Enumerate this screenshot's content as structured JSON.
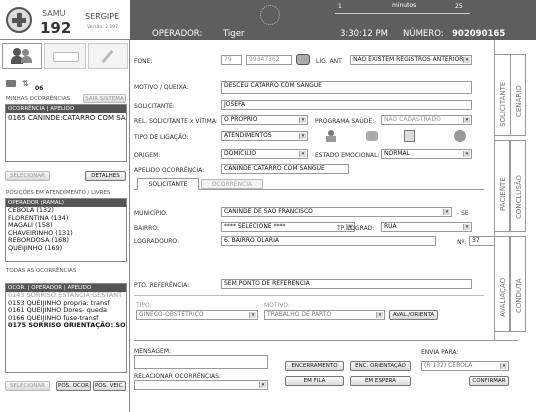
{
  "header": {
    "logo_brand": "SAMU",
    "logo_number": "192",
    "city": "SERGIPE",
    "version": "Versão: 2.197",
    "timer_minutes_left": "1",
    "timer_label": "minutos",
    "timer_minutes_right": "25",
    "operator_label": "OPERADOR:",
    "operator_name": "Tiger",
    "clock": "3:30:12 PM",
    "number_label": "NÚMERO:",
    "number_value": "902090165"
  },
  "sidebar": {
    "messages_count": "06",
    "my_occurrences_label": "MINHAS OCORRÊNCIAS",
    "exit_system_button": "SAIR SISTEMA",
    "my_list_header": "OCORRÊNCIA | APELIDO",
    "my_list_items": [
      "0165 CANINDE:CATARRO COM SAN"
    ],
    "select_button": "SELECIONAR",
    "details_button": "DETALHES",
    "positions_label": "POSIÇÕES EM ATENDIMENTO / LIVRES",
    "operators_header": "OPERADOR (RAMAL)",
    "operators": [
      "CEBOLA (132)",
      "FLORENTINA (134)",
      "MAGALI (158)",
      "CHAVEIRINHO (131)",
      "REBORDOSA (168)",
      "QUEIJINHO (169)"
    ],
    "all_occurrences_label": "TODAS AS OCORRÊNCIAS",
    "all_header": "OCOR. | OPERADOR | APELIDO",
    "all_items": [
      {
        "text": "0143 SORRISO ESTANCIA:GESTANT",
        "muted": true
      },
      {
        "text": "0153 QUEIJINHO propria: transf",
        "muted": false
      },
      {
        "text": "0161 QUEIJINHO Dores- queda",
        "muted": false
      },
      {
        "text": "0166 QUEIJINHO fuse-transf",
        "muted": false
      },
      {
        "text": "0175 SORRISO ORIENTAÇÃO: SOCC",
        "muted": false
      }
    ],
    "select_button_2": "SELECIONAR",
    "pos_ocor_button": "POS. OCOR",
    "pos_veic_button": "POS. VEIC."
  },
  "form": {
    "phone_label": "FONE:",
    "phone_ddd": "79",
    "phone_number": "99347362",
    "lig_ant_label": "LIG. ANT",
    "lig_ant_value": "NÃO EXISTEM REGISTROS ANTERIOR",
    "motivo_label": "MOTIVO / QUEIXA:",
    "motivo_value": "DESCEU CATARRO COM SANGUE",
    "solicitante_label": "SOLICITANTE:",
    "solicitante_value": "JOSEFA",
    "rel_label": "REL. SOLICITANTE x VÍTIMA:",
    "rel_value": "O PRÓPRIO",
    "programa_label": "PROGRAMA SAÚDE:",
    "programa_value": "NÃO CADASTRADO",
    "tipo_lig_label": "TIPO DE LIGAÇÃO:",
    "tipo_lig_value": "ATENDIMENTOS",
    "origem_label": "ORIGEM:",
    "origem_value": "DOMICÍLIO",
    "estado_label": "ESTADO EMOCIONAL:",
    "estado_value": "NORMAL",
    "apelido_label": "APELIDO OCORRÊNCIA:",
    "apelido_value": "CANINDE CATARRO COM SANGUE",
    "tab_solicitante": "SOLICITANTE",
    "tab_ocorrencia": "OCORRÊNCIA",
    "municipio_label": "MUNICÍPIO:",
    "municipio_value": "CANINDE DE SAO FRANCISCO",
    "uf_value": "- SE",
    "bairro_label": "BAIRRO:",
    "bairro_value": "**** SELECIONE ****",
    "tp_lograd_label": "TP. LOGRAD:",
    "tp_lograd_value": "RUA",
    "logradouro_label": "LOGRADOURO:",
    "logradouro_value": "6. BAIRRO OLARIA",
    "numero_label": "Nº:",
    "numero_value": "37",
    "pto_ref_label": "PTO. REFERÊNCIA:",
    "pto_ref_value": "SEM PONTO DE REFERENCIA",
    "tipo_label": "TIPO:",
    "tipo_value": "GINECO-OBSTÉTRICO",
    "motivo2_label": "MOTIVO:",
    "motivo2_value": "TRABALHO DE PARTO",
    "aval_button": "AVAL./ORIENTA",
    "mensagem_label": "MENSAGEM:",
    "relacionar_label": "RELACIONAR OCORRÊNCIAS:",
    "encerramento_button": "ENCERRAMENTO",
    "enc_orientacao_button": "ENC. ORIENTAÇÃO",
    "em_fila_button": "EM FILA",
    "em_espera_button": "EM ESPERA",
    "envia_para_label": "ENVIA PARA:",
    "envia_para_value": "(R 132) CEBOLA",
    "confirmar_button": "CONFIRMAR"
  },
  "side_tabs": {
    "solicitante": "SOLICITANTE",
    "cenario": "CENÁRIO",
    "paciente": "PACIENTE",
    "conclusao": "CONCLUSÃO",
    "avaliacao": "AVALIAÇÃO",
    "conduta": "CONDUTA"
  }
}
